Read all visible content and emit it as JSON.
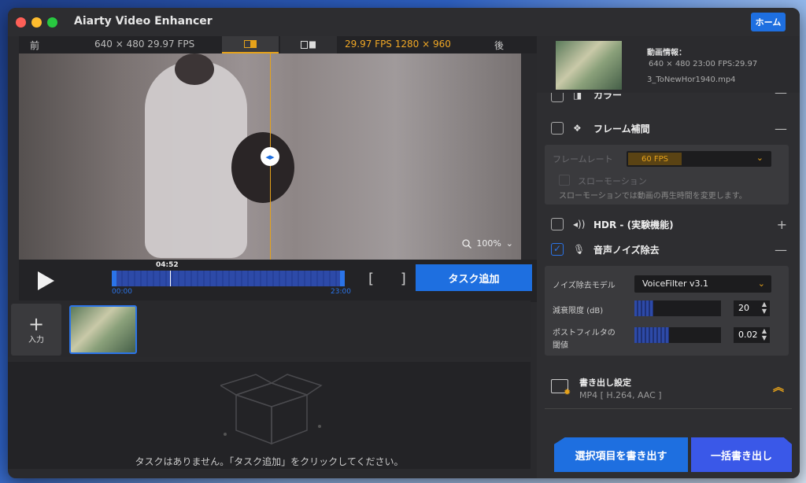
{
  "window": {
    "title": "Aiarty Video Enhancer",
    "home_label": "ホーム"
  },
  "compare": {
    "before_label": "前",
    "after_label": "後",
    "left_info": "640 × 480   29.97 FPS",
    "right_info": "29.97 FPS   1280 × 960"
  },
  "preview": {
    "zoom": "100%"
  },
  "timeline": {
    "current": "04:52",
    "start": "00:00",
    "end": "23:00",
    "brackets": "[ ]",
    "add_task": "タスク追加"
  },
  "inputs": {
    "add_label": "入力"
  },
  "tasks": {
    "empty_message": "タスクはありません。「タスク追加」をクリックしてください。"
  },
  "video_info": {
    "title": "動画情報：",
    "specs": "640 × 480 23:00 FPS:29.97",
    "filename": "3_ToNewHor1940.mp4"
  },
  "modules": {
    "color": {
      "label": "カラー",
      "checked": false
    },
    "frame_interp": {
      "label": "フレーム補間",
      "checked": false
    },
    "hdr": {
      "label": "HDR - (実験機能)",
      "checked": false
    },
    "noise": {
      "label": "音声ノイズ除去",
      "checked": true
    }
  },
  "frame_interp": {
    "rate_label": "フレームレート",
    "rate_value": "60 FPS",
    "slow_label": "スローモーション",
    "slow_note": "スローモーションでは動画の再生時間を変更します。"
  },
  "noise": {
    "model_label": "ノイズ除去モデル",
    "model_value": "VoiceFilter v3.1",
    "attn_label": "減衰限度 (dB)",
    "attn_value": "20",
    "post_label_1": "ポストフィルタの",
    "post_label_2": "閾値",
    "post_value": "0.02"
  },
  "export": {
    "title": "書き出し設定",
    "format": "MP4 [ H.264, AAC ]",
    "selected_btn": "選択項目を書き出す",
    "all_btn": "一括書き出し"
  },
  "colors": {
    "accent": "#1e6fe0",
    "highlight": "#e6a21a",
    "panel": "#2e2e31"
  }
}
